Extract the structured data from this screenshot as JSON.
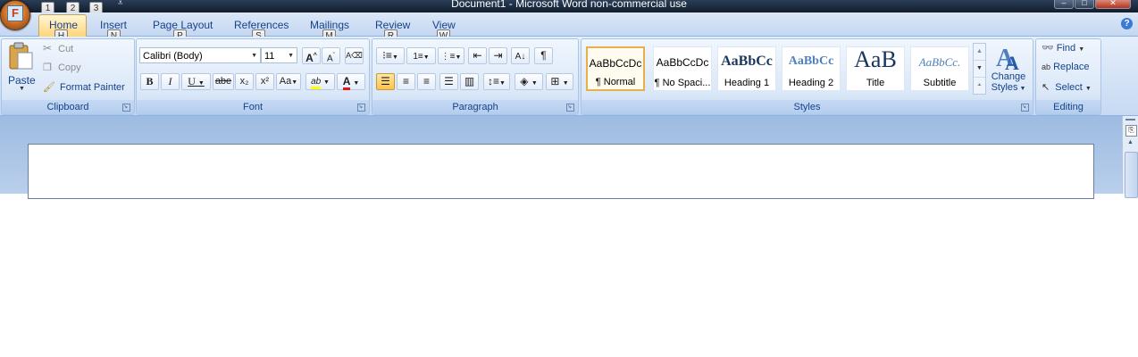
{
  "window": {
    "title": "Document1 - Microsoft Word non-commercial use",
    "minimize_glyph": "–",
    "maximize_glyph": "□",
    "close_glyph": "✕"
  },
  "office_button": {
    "letter": "F"
  },
  "qat_keytips": [
    "1",
    "2",
    "3"
  ],
  "tabs": [
    {
      "label": "Home",
      "keytip": "H"
    },
    {
      "label": "Insert",
      "keytip": "N"
    },
    {
      "label": "Page Layout",
      "keytip": "P"
    },
    {
      "label": "References",
      "keytip": "S"
    },
    {
      "label": "Mailings",
      "keytip": "M"
    },
    {
      "label": "Review",
      "keytip": "R"
    },
    {
      "label": "View",
      "keytip": "W"
    }
  ],
  "help_glyph": "?",
  "clipboard": {
    "caption": "Clipboard",
    "paste": "Paste",
    "cut": "Cut",
    "copy": "Copy",
    "format_painter": "Format Painter"
  },
  "font": {
    "caption": "Font",
    "font_name": "Calibri (Body)",
    "font_size": "11",
    "grow": "A",
    "shrink": "A",
    "bold": "B",
    "italic": "I",
    "underline": "U",
    "strike": "abe",
    "subscript": "x₂",
    "superscript": "x²",
    "change_case": "Aa",
    "highlight": "ab",
    "font_color": "A"
  },
  "paragraph": {
    "caption": "Paragraph",
    "show_marks": "¶"
  },
  "styles": {
    "caption": "Styles",
    "items": [
      {
        "preview": "AaBbCcDc",
        "name": "¶ Normal"
      },
      {
        "preview": "AaBbCcDc",
        "name": "¶ No Spaci..."
      },
      {
        "preview": "AaBbCc",
        "name": "Heading 1"
      },
      {
        "preview": "AaBbCc",
        "name": "Heading 2"
      },
      {
        "preview": "AaB",
        "name": "Title"
      },
      {
        "preview": "AaBbCc.",
        "name": "Subtitle"
      }
    ],
    "change_styles_line1": "Change",
    "change_styles_line2": "Styles"
  },
  "editing": {
    "caption": "Editing",
    "find": "Find",
    "replace": "Replace",
    "select": "Select"
  },
  "colors": {
    "accent_text": "#15428b",
    "highlight": "#ffff00",
    "font_color": "#e0191e",
    "selected_button": "#ffc24a"
  }
}
